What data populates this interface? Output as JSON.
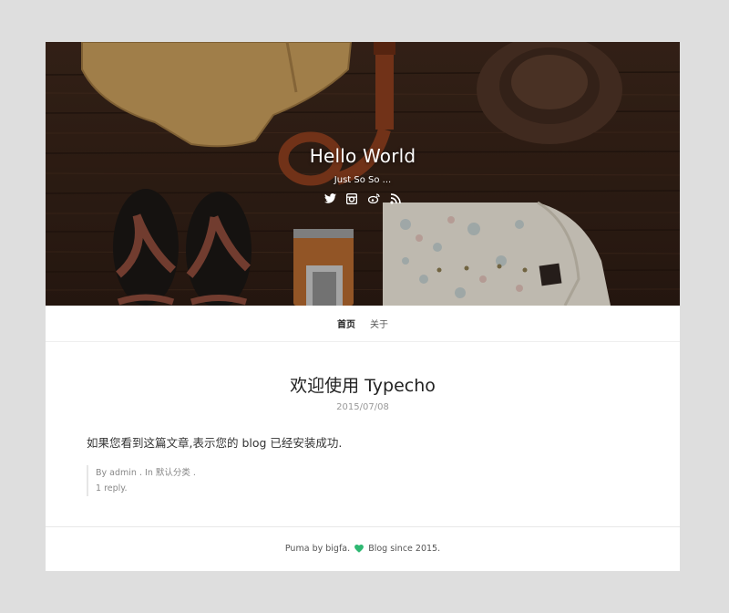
{
  "site": {
    "title": "Hello World",
    "description": "Just So So ..."
  },
  "social_icons": [
    "twitter-icon",
    "instagram-icon",
    "weibo-icon",
    "rss-icon"
  ],
  "nav": {
    "items": [
      {
        "label": "首页",
        "active": true
      },
      {
        "label": "关于",
        "active": false
      }
    ]
  },
  "post": {
    "title": "欢迎使用 Typecho",
    "date": "2015/07/08",
    "body": "如果您看到这篇文章,表示您的 blog 已经安装成功.",
    "meta": {
      "by_prefix": "By ",
      "author": "admin",
      "in_prefix": " . In ",
      "category": "默认分类",
      "category_suffix": " .",
      "replies": "1 reply."
    }
  },
  "footer": {
    "theme": "Puma",
    "by_text": " by ",
    "author": "bigfa.",
    "since": " Blog since 2015."
  },
  "colors": {
    "page_bg": "#dedede",
    "heart": "#2eb872",
    "wood": "#4a3022"
  }
}
